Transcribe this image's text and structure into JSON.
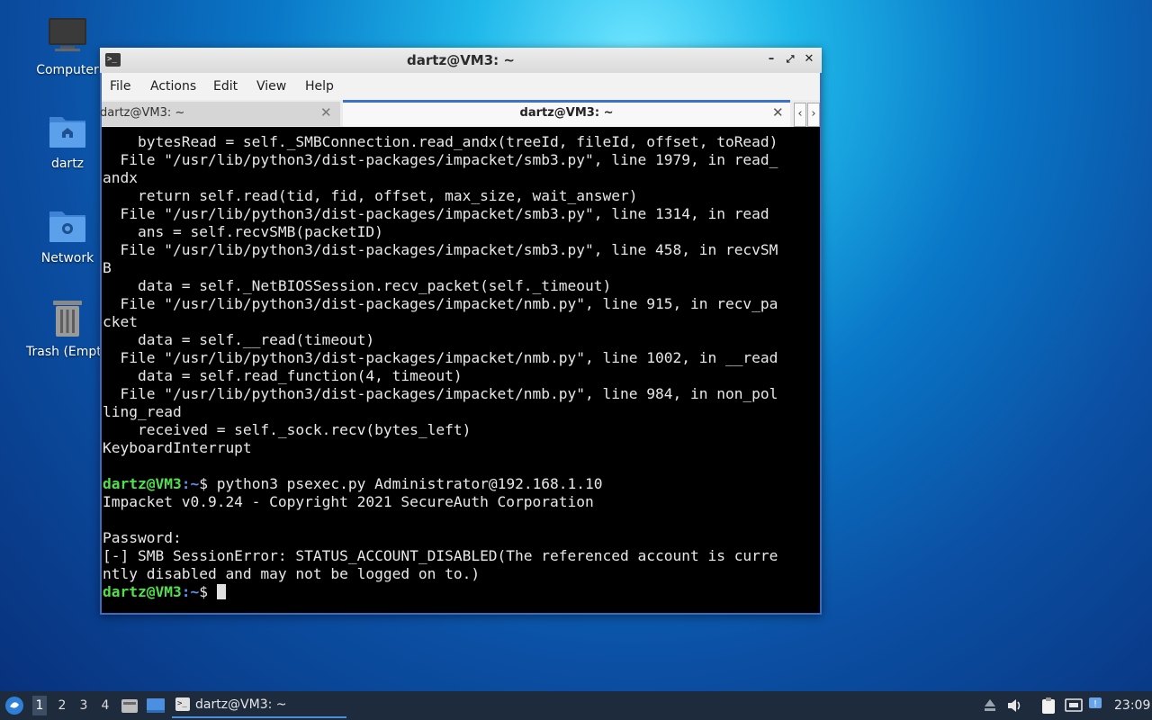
{
  "desktop": {
    "icons": [
      {
        "label": "Computer",
        "icon": "computer-icon"
      },
      {
        "label": "dartz",
        "icon": "home-folder-icon"
      },
      {
        "label": "Network",
        "icon": "network-folder-icon"
      },
      {
        "label": "Trash (Empty)",
        "icon": "trash-icon"
      }
    ]
  },
  "window": {
    "title": "dartz@VM3: ~",
    "menu": [
      "File",
      "Actions",
      "Edit",
      "View",
      "Help"
    ],
    "tabs": [
      {
        "label": "dartz@VM3: ~",
        "active": false
      },
      {
        "label": "dartz@VM3: ~",
        "active": true
      }
    ]
  },
  "terminal": {
    "traceback": [
      "    bytesRead = self._SMBConnection.read_andx(treeId, fileId, offset, toRead)",
      "  File \"/usr/lib/python3/dist-packages/impacket/smb3.py\", line 1979, in read_",
      "andx",
      "    return self.read(tid, fid, offset, max_size, wait_answer)",
      "  File \"/usr/lib/python3/dist-packages/impacket/smb3.py\", line 1314, in read",
      "    ans = self.recvSMB(packetID)",
      "  File \"/usr/lib/python3/dist-packages/impacket/smb3.py\", line 458, in recvSM",
      "B",
      "    data = self._NetBIOSSession.recv_packet(self._timeout)",
      "  File \"/usr/lib/python3/dist-packages/impacket/nmb.py\", line 915, in recv_pa",
      "cket",
      "    data = self.__read(timeout)",
      "  File \"/usr/lib/python3/dist-packages/impacket/nmb.py\", line 1002, in __read",
      "    data = self.read_function(4, timeout)",
      "  File \"/usr/lib/python3/dist-packages/impacket/nmb.py\", line 984, in non_pol",
      "ling_read",
      "    received = self._sock.recv(bytes_left)",
      "KeyboardInterrupt",
      ""
    ],
    "prompt_user": "dartz@VM3",
    "prompt_path": ":~",
    "prompt_sym": "$ ",
    "command": "python3 psexec.py Administrator@192.168.1.10",
    "output": [
      "Impacket v0.9.24 - Copyright 2021 SecureAuth Corporation",
      "",
      "Password:",
      "[-] SMB SessionError: STATUS_ACCOUNT_DISABLED(The referenced account is curre",
      "ntly disabled and may not be logged on to.)"
    ]
  },
  "taskbar": {
    "workspaces": [
      "1",
      "2",
      "3",
      "4"
    ],
    "active_workspace": "1",
    "task_label": "dartz@VM3: ~",
    "clock": "23:09"
  }
}
